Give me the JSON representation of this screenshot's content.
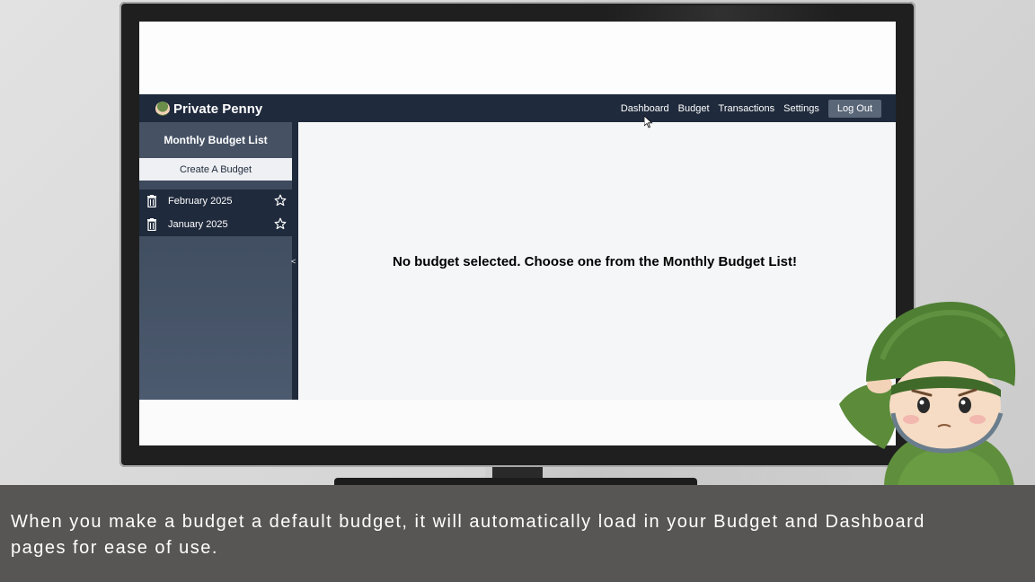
{
  "app": {
    "brand": "Private Penny",
    "nav": [
      "Dashboard",
      "Budget",
      "Transactions",
      "Settings"
    ],
    "logout_label": "Log Out"
  },
  "sidebar": {
    "title": "Monthly Budget List",
    "create_label": "Create A Budget",
    "items": [
      {
        "label": "February 2025"
      },
      {
        "label": "January 2025"
      }
    ],
    "collapse_glyph": "<"
  },
  "main": {
    "message": "No budget selected. Choose one from the Monthly Budget List!"
  },
  "caption": {
    "text": "When you make a budget a default budget, it will automatically load in your Budget and Dashboard pages for ease of use."
  },
  "colors": {
    "navbar": "#1f2a3c",
    "sidebar": "#3a4658",
    "caption_bg": "#575654"
  },
  "icons": [
    "trash-icon",
    "star-icon",
    "mouse-cursor-icon",
    "soldier-mascot"
  ]
}
